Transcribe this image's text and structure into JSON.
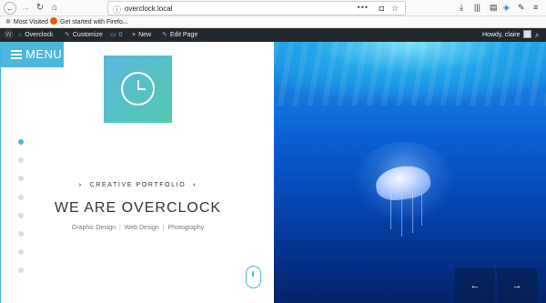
{
  "browser": {
    "url": "overclock.local",
    "url_dots": "•••",
    "bookmarks": [
      {
        "label": "Most Visited"
      },
      {
        "label": "Get started with Firefo..."
      }
    ]
  },
  "wp_admin_bar": {
    "site_name": "Overclock",
    "customize": "Customize",
    "comments_count": "0",
    "new": "New",
    "edit_page": "Edit Page",
    "greeting": "Howdy, claire"
  },
  "page": {
    "menu_label": "MENU",
    "kicker": "CREATIVE PORTFOLIO",
    "headline": "WE ARE OVERCLOCK",
    "services": [
      "Graphic Design",
      "Web Design",
      "Photography"
    ],
    "service_separator": "|",
    "slide_dots": 8,
    "active_slide_dot": 1
  },
  "slider": {
    "prev_arrow": "←",
    "next_arrow": "→"
  },
  "icons": {
    "logo": "clock-icon",
    "scroll": "mouse-icon"
  },
  "colors": {
    "accent": "#4db6dc",
    "logo_gradient_start": "#5bb7df",
    "logo_gradient_end": "#52c9b0",
    "wp_bar": "#23282d",
    "hero_blue": "#0b62d4"
  }
}
